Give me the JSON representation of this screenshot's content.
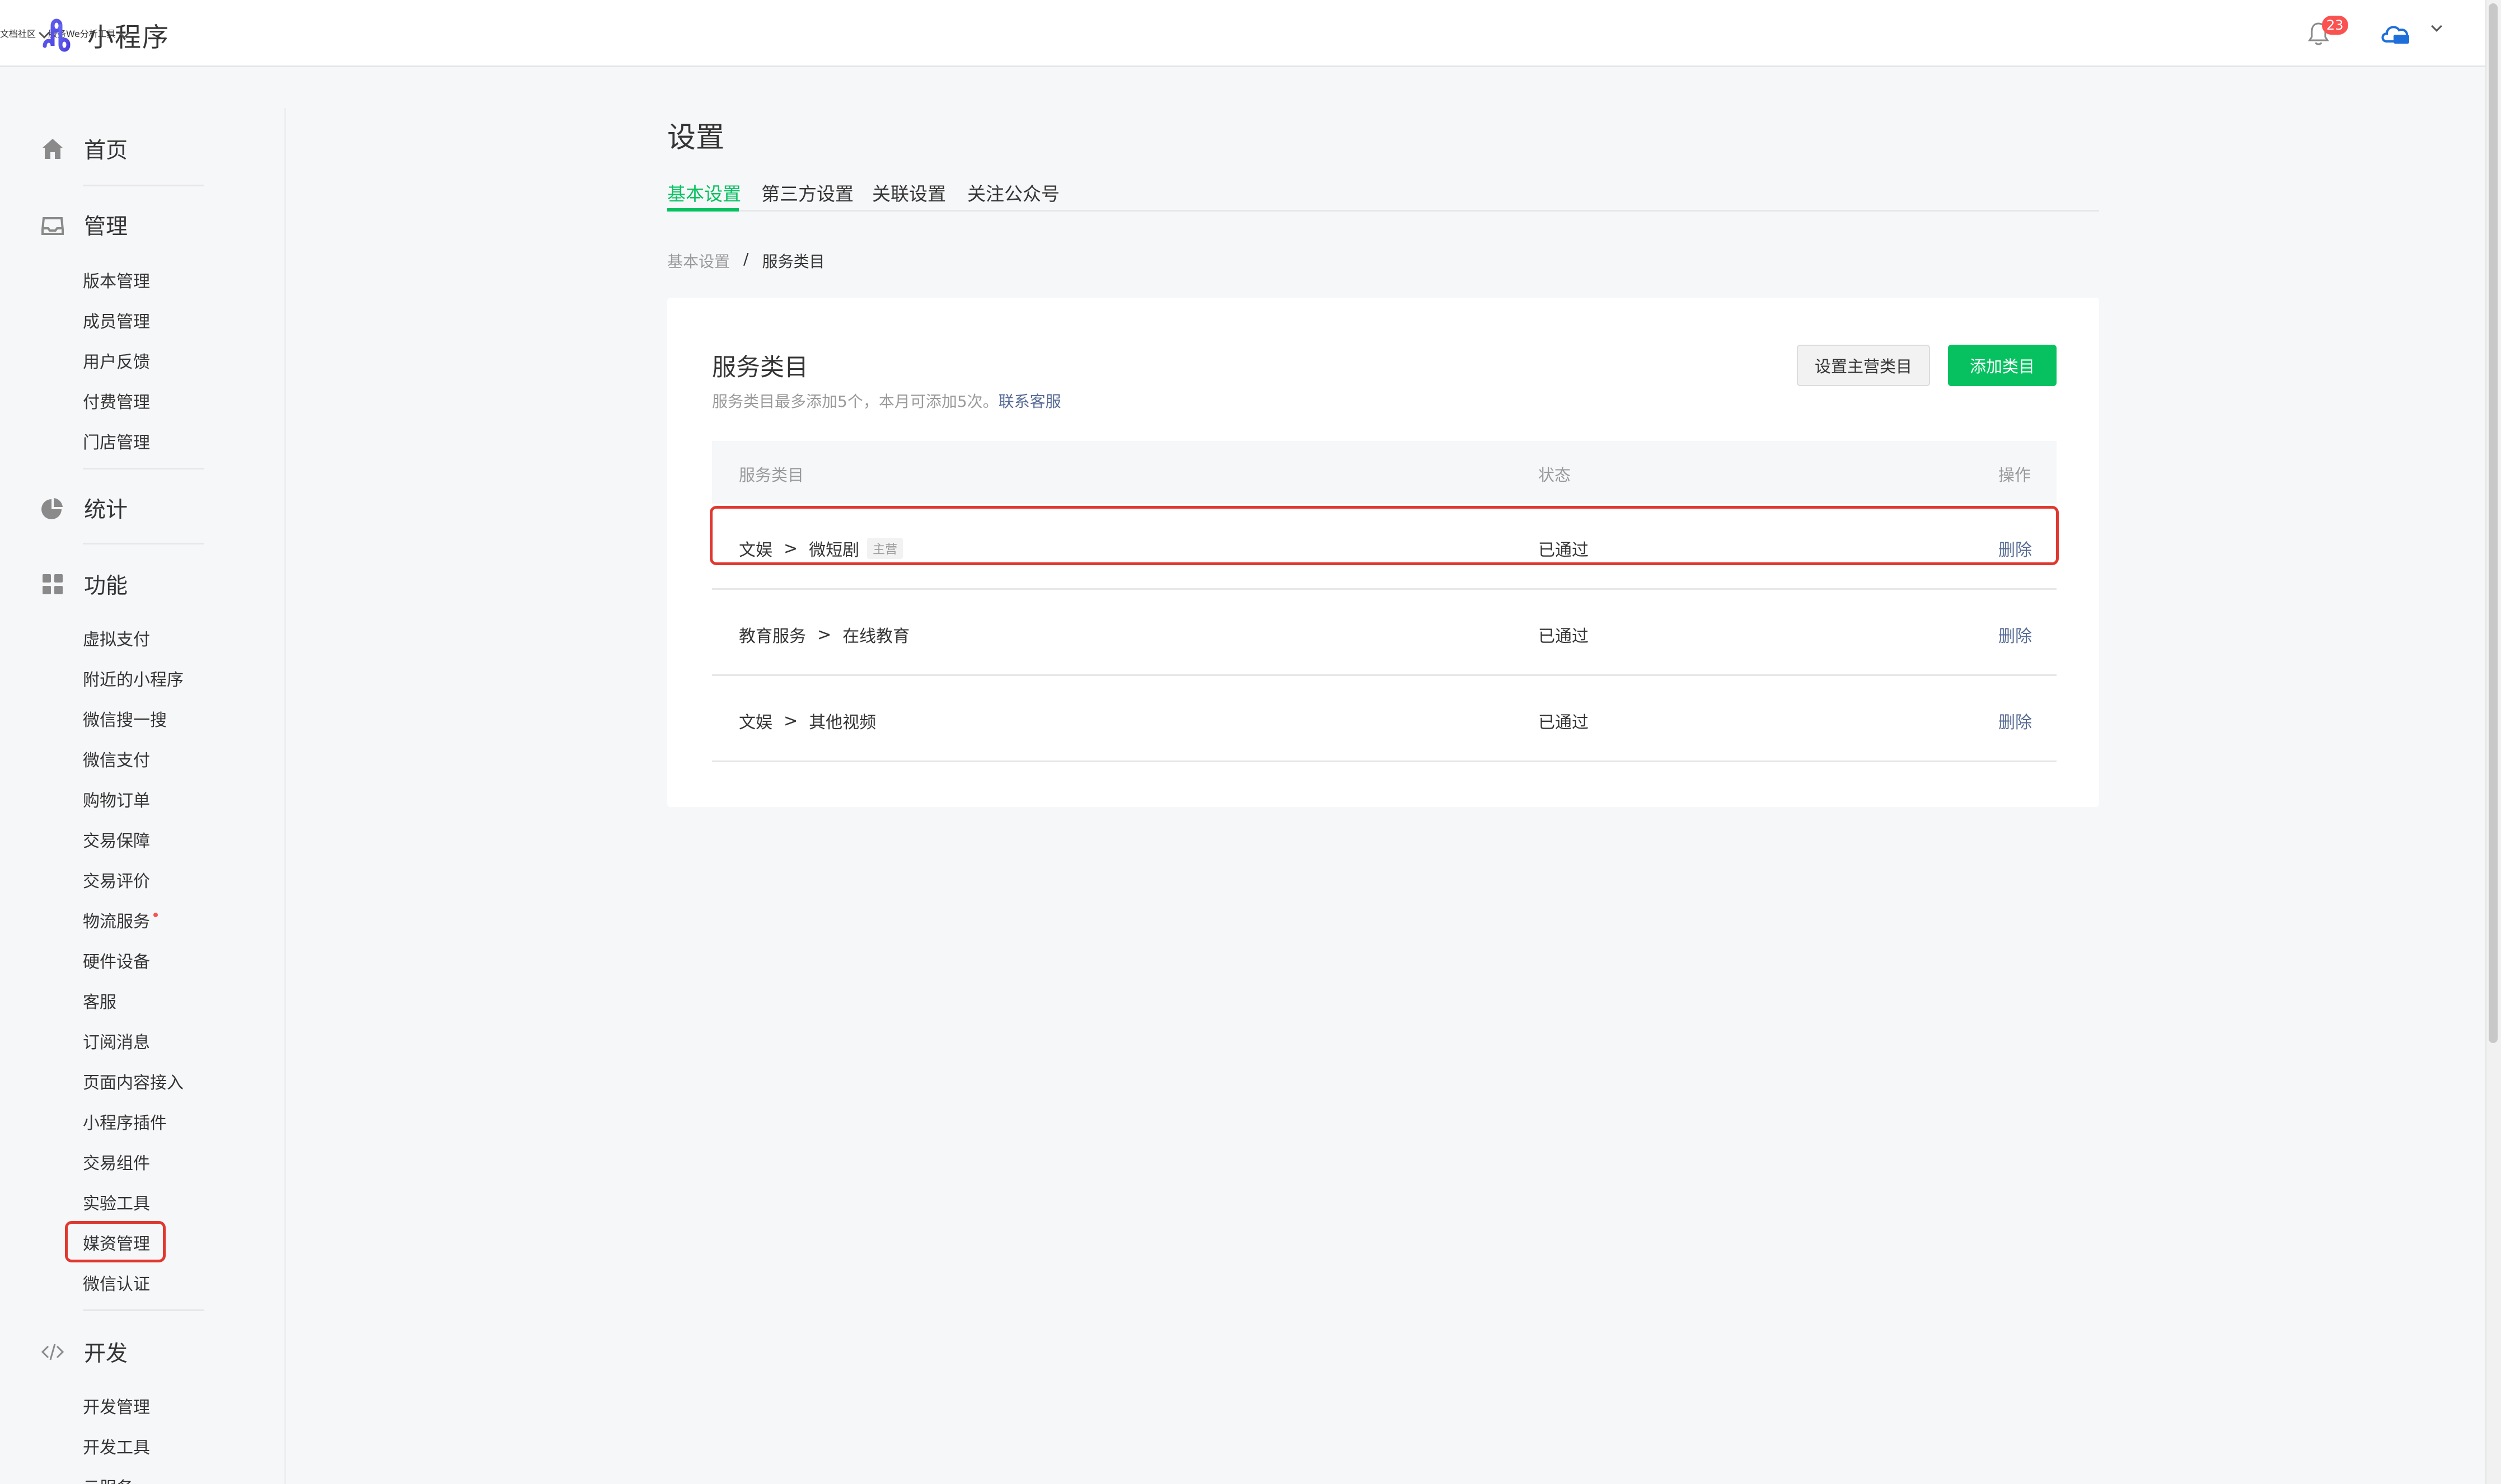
{
  "header": {
    "app_name": "小程序",
    "nav": [
      {
        "label": "文档",
        "dropdown": false
      },
      {
        "label": "社区",
        "dropdown": true
      },
      {
        "label": "服务",
        "dropdown": false
      },
      {
        "label": "We分析",
        "dropdown": false
      },
      {
        "label": "工具",
        "dropdown": true
      }
    ],
    "notification_count": "23",
    "icons": [
      "logo-icon",
      "bell-icon",
      "cloud-account-icon",
      "chevron-down-icon"
    ]
  },
  "sidebar": {
    "home": {
      "label": "首页",
      "icon": "home-icon"
    },
    "manage": {
      "label": "管理",
      "icon": "inbox-icon",
      "items": [
        "版本管理",
        "成员管理",
        "用户反馈",
        "付费管理",
        "门店管理"
      ]
    },
    "stats": {
      "label": "统计",
      "icon": "pie-chart-icon"
    },
    "features": {
      "label": "功能",
      "icon": "grid-icon",
      "items": [
        "虚拟支付",
        "附近的小程序",
        "微信搜一搜",
        "微信支付",
        "购物订单",
        "交易保障",
        "交易评价",
        "物流服务",
        "硬件设备",
        "客服",
        "订阅消息",
        "页面内容接入",
        "小程序插件",
        "交易组件",
        "实验工具",
        "媒资管理",
        "微信认证"
      ]
    },
    "dev": {
      "label": "开发",
      "icon": "code-icon",
      "items": [
        "开发管理",
        "开发工具",
        "云服务"
      ]
    },
    "highlighted_item": "媒资管理",
    "new_dot_item": "物流服务"
  },
  "main": {
    "title": "设置",
    "tabs": [
      "基本设置",
      "第三方设置",
      "关联设置",
      "关注公众号"
    ],
    "active_tab": "基本设置",
    "breadcrumb": [
      "基本设置",
      "服务类目"
    ],
    "breadcrumb_sep": "/",
    "card": {
      "title": "服务类目",
      "desc_prefix": "服务类目最多添加5个，本月可添加5次。",
      "desc_link": "联系客服",
      "btn_set_main": "设置主营类目",
      "btn_add": "添加类目"
    },
    "table": {
      "headers": [
        "服务类目",
        "状态",
        "操作"
      ],
      "rows": [
        {
          "cat1": "文娱",
          "cat2": "微短剧",
          "tag": "主营",
          "status": "已通过",
          "action": "删除"
        },
        {
          "cat1": "教育服务",
          "cat2": "在线教育",
          "tag": "",
          "status": "已通过",
          "action": "删除"
        },
        {
          "cat1": "文娱",
          "cat2": "其他视频",
          "tag": "",
          "status": "已通过",
          "action": "删除"
        }
      ],
      "separator": ">"
    }
  },
  "colors": {
    "accent_green": "#07c160",
    "link_blue": "#576b95",
    "badge_red": "#fa5151",
    "highlight_red": "#e0382f"
  }
}
